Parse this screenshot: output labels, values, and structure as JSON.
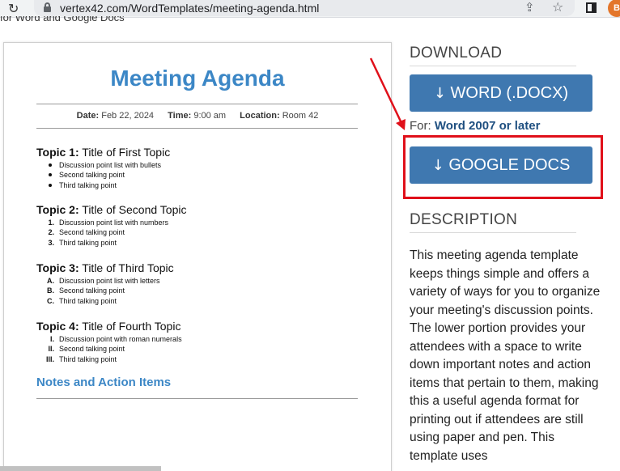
{
  "browser": {
    "url": "vertex42.com/WordTemplates/meeting-agenda.html",
    "avatar_initial": "B"
  },
  "page_peek": "for Word and Google Docs",
  "preview": {
    "title": "Meeting Agenda",
    "meta": {
      "date_label": "Date:",
      "date_value": "Feb 22, 2024",
      "time_label": "Time:",
      "time_value": "9:00 am",
      "location_label": "Location:",
      "location_value": "Room 42"
    },
    "topics": [
      {
        "label": "Topic 1:",
        "title": "Title of First Topic",
        "style": "bullets",
        "points": [
          "Discussion point list with bullets",
          "Second talking point",
          "Third talking point"
        ]
      },
      {
        "label": "Topic 2:",
        "title": "Title of Second Topic",
        "style": "numbers",
        "markers": [
          "1.",
          "2.",
          "3."
        ],
        "points": [
          "Discussion point list with numbers",
          "Second talking point",
          "Third talking point"
        ]
      },
      {
        "label": "Topic 3:",
        "title": "Title of Third Topic",
        "style": "letters",
        "markers": [
          "A.",
          "B.",
          "C."
        ],
        "points": [
          "Discussion point list with letters",
          "Second talking point",
          "Third talking point"
        ]
      },
      {
        "label": "Topic 4:",
        "title": "Title of Fourth Topic",
        "style": "roman",
        "markers": [
          "I.",
          "II.",
          "III."
        ],
        "points": [
          "Discussion point with roman numerals",
          "Second talking point",
          "Third talking point"
        ]
      }
    ],
    "notes_title": "Notes and Action Items"
  },
  "sidebar": {
    "download_heading": "DOWNLOAD",
    "word_button": "WORD (.DOCX)",
    "for_label": "For:",
    "for_value": "Word 2007 or later",
    "google_button": "GOOGLE DOCS",
    "description_heading": "DESCRIPTION",
    "description": "This meeting agenda template keeps things simple and offers a variety of ways for you to organize your meeting's discussion points. The lower portion provides your attendees with a space to write down important notes and action items that pertain to them, making this a useful agenda format for printing out if attendees are still using paper and pen. This template uses"
  },
  "colors": {
    "accent_blue": "#3c87c6",
    "button_blue": "#3f78b0",
    "highlight_red": "#e0101a"
  }
}
